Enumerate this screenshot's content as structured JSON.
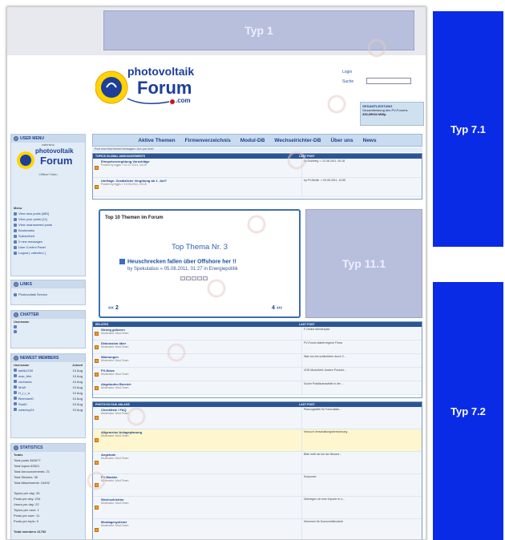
{
  "ads": {
    "top": "Typ 1",
    "right_top": "Typ 7.1",
    "middle": "Typ 11.1",
    "right_bottom": "Typ 7.2"
  },
  "logo": {
    "line1": "photovoltaik",
    "line2": "Forum",
    "line3": ".com"
  },
  "header": {
    "login": "Login",
    "search": "Suche",
    "stats_title": "GESAMTLEISTUNG",
    "stats_line1": "Gesamtleistung des PV-Forums",
    "stats_line2": "330,99004 MWp"
  },
  "nav": {
    "items": [
      "Aktive Themen",
      "Firmenverzeichnis",
      "Modul-DB",
      "Wechselrichter-DB",
      "Über uns",
      "News"
    ],
    "subnav": "Post new New thread messages • Are you level"
  },
  "sidebar": {
    "user_menu": "USER MENU",
    "user_name": "valentino",
    "online": "Offline? Nein",
    "menu_title": "Menu",
    "menu_items": [
      "View new posts [485]",
      "View your posts [11]",
      "View unanswered posts",
      "Bookmarks",
      "Subscribed",
      "0 new messages",
      "User Control Panel",
      "Logout [ valentino ]"
    ],
    "links_title": "LINKS",
    "links_item": "Photovoltaik Service",
    "chatter_title": "CHATTER",
    "chatter_username": "Username",
    "newest_title": "NEWEST MEMBERS",
    "newest_cols": [
      "Username",
      "Joined"
    ],
    "newest_rows": [
      [
        "karlik1230",
        "10 Aug"
      ],
      [
        "mac_fritz",
        "10 Aug"
      ],
      [
        "vonhardo",
        "10 Aug"
      ],
      [
        "MoW",
        "10 Aug"
      ],
      [
        "H_i_r_a",
        "10 Aug"
      ],
      [
        "Bernhard0",
        "10 Aug"
      ],
      [
        "Rudi0",
        "10 Aug"
      ],
      [
        "solarboy24",
        "10 Aug"
      ]
    ],
    "stats_title": "STATISTICS",
    "stats_totals": "Totals",
    "stats_lines": [
      "Total posts 562677",
      "Total topics 63521",
      "Total Announcements: 21",
      "Total Stickies: 35",
      "Total Attachments: 10492"
    ],
    "stats_lines2": [
      "Topics per day: 26",
      "Posts per day: 234",
      "Users per day: 22",
      "Topics per user: 1",
      "Posts per user: 11",
      "Posts per topic: 9"
    ],
    "total_members": "Total members 31752"
  },
  "global": {
    "header": "TOPICS GLOBAL ANNOUNCEMENTS",
    "last": "LAST POST",
    "rows": [
      {
        "t": "Einspeisevergütung Vorschläge",
        "d": "Posted by eggis » 01.07.2011, 16:29",
        "l": "by Eschbrig ⇨ 22.08.2011, 00:18"
      },
      {
        "t": "Umfrage: Zusätzliche Vergütung ab 1. Juli?",
        "d": "Posted by eggis » 10.06.2011, 20:18",
        "l": "by PV-Berlin ⇨ 09.06.2011, 14:55"
      }
    ]
  },
  "top10": {
    "title": "Top 10 Themen im Forum",
    "subtitle": "Top Thema Nr. 3",
    "topic": "Heuschrecken fallen über Offshore her !!",
    "by": "by Spekulatius » 05.08.2011, 01:27 in Energiepolitik",
    "prev": "‹‹‹ 2",
    "next": "4 ›››"
  },
  "forum1": {
    "header": "RELATED",
    "last": "LAST POST",
    "rows": [
      {
        "t": "Strong geboren",
        "d": "Moderator: Mod-Team",
        "l": "F-Online Meisterplan",
        "hl": false
      },
      {
        "t": "Diskussion über",
        "d": "Moderator: Mod-Team",
        "l": "PV-Forum startet eigene Firma",
        "hl": false
      },
      {
        "t": "Warnungen",
        "d": "Moderator: Mod-Team",
        "l": "Was tun bei schlechtem durch C...",
        "hl": false
      },
      {
        "t": "PV-News",
        "d": "Moderator: Mod-Team",
        "l": "VDE-Modulheft: Andere Produkt...",
        "hl": false
      },
      {
        "t": "Abgelaufen Bereich",
        "d": "Moderator: Mod-Team",
        "l": "Suche Praktikumsstelle in der ...",
        "hl": false
      }
    ]
  },
  "forum2": {
    "header": "PHOTOVOLTAIK ANLAGE",
    "last": "LAST POST",
    "rows": [
      {
        "t": "Checkliste / FAQ",
        "d": "Moderator: Mod-Team",
        "l": "Planungshilfe für Fotovoltaik...",
        "hl": false
      },
      {
        "t": "Allgemeine Anlageplanung",
        "d": "Moderator: Mod-Team",
        "l": "Versuch Verschattungsberechnung",
        "hl": true
      },
      {
        "t": "Angebote",
        "d": "Moderator: Mod-Team",
        "l": "Bitte helft mir bei der Bewert...",
        "hl": false
      },
      {
        "t": "PV-Module",
        "d": "Moderator: Mod-Team",
        "l": "Sunpower",
        "hl": false
      },
      {
        "t": "Wechselrichter",
        "d": "Moderator: Mod-Team",
        "l": "Überlegen ob eine Kipover er s...",
        "hl": false
      },
      {
        "t": "Montagesysteme",
        "d": "Moderator: Mod-Team",
        "l": "Klemmen für Domschrittmodule",
        "hl": false
      }
    ]
  }
}
